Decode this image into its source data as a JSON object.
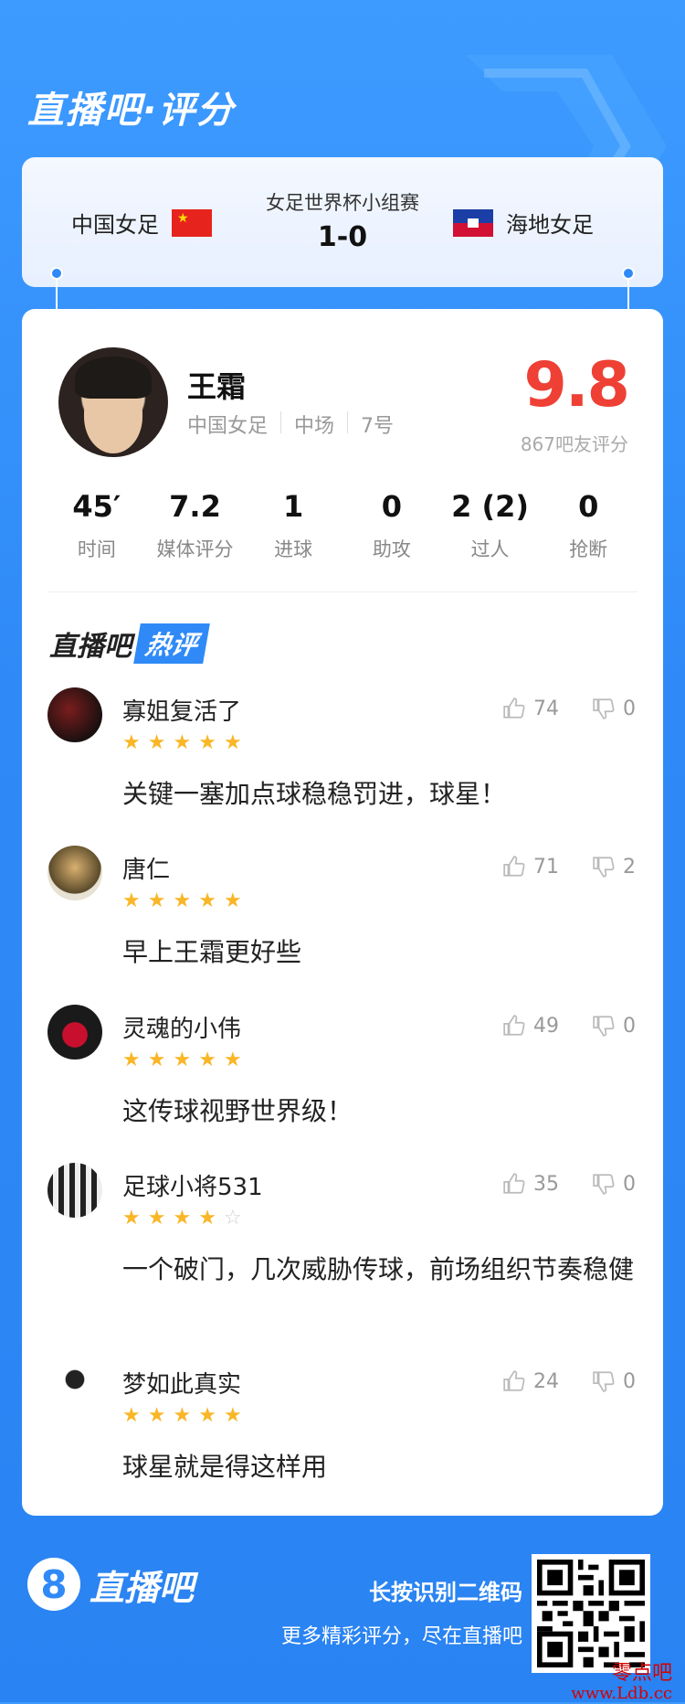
{
  "header": {
    "title": "直播吧·评分"
  },
  "match": {
    "tournament": "女足世界杯小组赛",
    "score": "1-0",
    "home_team": "中国女足",
    "away_team": "海地女足"
  },
  "player": {
    "name": "王霜",
    "team": "中国女足",
    "position": "中场",
    "number": "7号",
    "rating": "9.8",
    "rating_count": "867吧友评分"
  },
  "stats": [
    {
      "value": "45′",
      "label": "时间"
    },
    {
      "value": "7.2",
      "label": "媒体评分"
    },
    {
      "value": "1",
      "label": "进球"
    },
    {
      "value": "0",
      "label": "助攻"
    },
    {
      "value": "2 (2)",
      "label": "过人"
    },
    {
      "value": "0",
      "label": "抢断"
    }
  ],
  "hot": {
    "prefix": "直播吧",
    "badge": "热评"
  },
  "comments": [
    {
      "user": "寡姐复活了",
      "stars": 5,
      "likes": "74",
      "dislikes": "0",
      "text": "关键一塞加点球稳稳罚进，球星！"
    },
    {
      "user": "唐仁",
      "stars": 5,
      "likes": "71",
      "dislikes": "2",
      "text": "早上王霜更好些"
    },
    {
      "user": "灵魂的小伟",
      "stars": 5,
      "likes": "49",
      "dislikes": "0",
      "text": "这传球视野世界级！"
    },
    {
      "user": "足球小将531",
      "stars": 4,
      "likes": "35",
      "dislikes": "0",
      "text": "一个破门，几次威胁传球，前场组织节奏稳健"
    },
    {
      "user": "梦如此真实",
      "stars": 5,
      "likes": "24",
      "dislikes": "0",
      "text": "球星就是得这样用"
    }
  ],
  "footer": {
    "logo_mark": "8",
    "logo_text": "直播吧",
    "qr_title": "长按识别二维码",
    "qr_subtitle": "更多精彩评分，尽在直播吧"
  },
  "watermark": {
    "text": "零点吧",
    "url": "www.Ldb.cc"
  },
  "colors": {
    "brand_blue": "#2f8af7",
    "rating_red": "#ee4035",
    "star_gold": "#f9b627"
  }
}
